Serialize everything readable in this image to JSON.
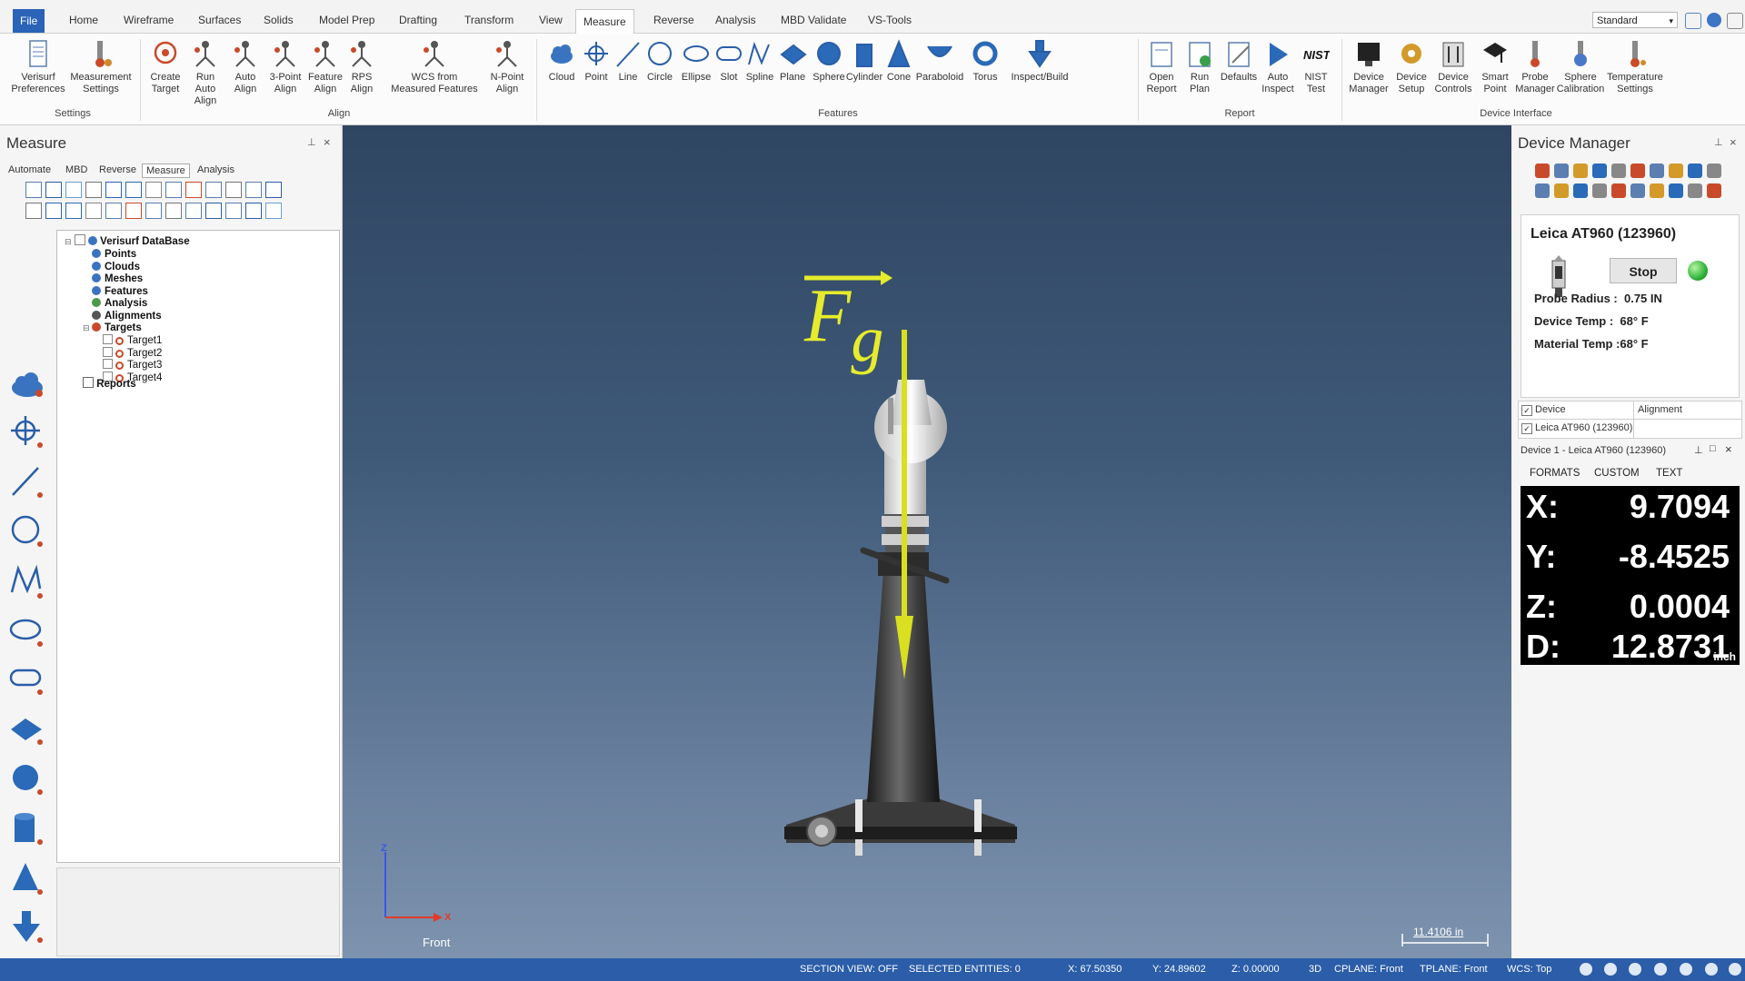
{
  "ribbon": {
    "tabs": [
      "File",
      "Home",
      "Wireframe",
      "Surfaces",
      "Solids",
      "Model Prep",
      "Drafting",
      "Transform",
      "View",
      "Measure",
      "Reverse",
      "Analysis",
      "MBD Validate",
      "VS-Tools"
    ],
    "active_tab": "Measure",
    "workspace": "Standard",
    "groups": {
      "settings": {
        "label": "Settings",
        "buttons": [
          "Verisurf\nPreferences",
          "Measurement\nSettings"
        ]
      },
      "align": {
        "label": "Align",
        "buttons": [
          "Create\nTarget",
          "Run Auto\nAlign",
          "Auto\nAlign",
          "3-Point\nAlign",
          "Feature\nAlign",
          "RPS\nAlign",
          "WCS from\nMeasured Features",
          "N-Point\nAlign"
        ]
      },
      "features": {
        "label": "Features",
        "buttons": [
          "Cloud",
          "Point",
          "Line",
          "Circle",
          "Ellipse",
          "Slot",
          "Spline",
          "Plane",
          "Sphere",
          "Cylinder",
          "Cone",
          "Paraboloid",
          "Torus",
          "Inspect/Build"
        ]
      },
      "report": {
        "label": "Report",
        "buttons": [
          "Open\nReport",
          "Run\nPlan",
          "Defaults",
          "Auto\nInspect",
          "NIST\nTest"
        ]
      },
      "device": {
        "label": "Device Interface",
        "buttons": [
          "Device\nManager",
          "Device\nSetup",
          "Device\nControls",
          "Smart\nPoint",
          "Probe\nManager",
          "Sphere\nCalibration",
          "Temperature\nSettings"
        ]
      }
    }
  },
  "left_panel": {
    "title": "Measure",
    "tabs": [
      "Automate",
      "MBD",
      "Reverse",
      "Measure",
      "Analysis"
    ],
    "active_tab": "Measure",
    "tree": {
      "root": "Verisurf DataBase",
      "items": [
        "Points",
        "Clouds",
        "Meshes",
        "Features",
        "Analysis",
        "Alignments",
        "Targets"
      ],
      "targets": [
        "Target1",
        "Target2",
        "Target3",
        "Target4"
      ],
      "reports": "Reports"
    }
  },
  "viewport": {
    "annotation_main": "F",
    "annotation_sub": "g",
    "view_name": "Front",
    "axis_x": "X",
    "axis_z": "Z",
    "scale": "11.4106 in",
    "colors": {
      "annotation": "#e6ec2c",
      "arrow": "#d8e020"
    }
  },
  "right_panel": {
    "title": "Device Manager",
    "device_name": "Leica AT960 (123960)",
    "stop_label": "Stop",
    "probe_radius_label": "Probe Radius :",
    "probe_radius": "0.75 IN",
    "device_temp_label": "Device Temp :",
    "device_temp": "68° F",
    "material_temp_label": "Material Temp :",
    "material_temp": "68° F",
    "table": {
      "col1": "Device",
      "col2": "Alignment",
      "row1": "Leica AT960 (123960)"
    },
    "readout_title": "Device 1 - Leica AT960 (123960)",
    "readout_tabs": [
      "FORMATS",
      "CUSTOM",
      "TEXT"
    ],
    "readout": {
      "x_label": "X:",
      "x": "9.7094",
      "y_label": "Y:",
      "y": "-8.4525",
      "z_label": "Z:",
      "z": "0.0004",
      "d_label": "D:",
      "d": "12.8731",
      "unit": "inch"
    },
    "status_color": "#30b33a"
  },
  "statusbar": {
    "section_view": "SECTION VIEW: OFF",
    "selected": "SELECTED ENTITIES: 0",
    "x": "X:  67.50350",
    "y": "Y:  24.89602",
    "z": "Z:  0.00000",
    "mode": "3D",
    "cplane": "CPLANE: Front",
    "tplane": "TPLANE: Front",
    "wcs": "WCS: Top",
    "bg_color": "#2b5da8"
  }
}
